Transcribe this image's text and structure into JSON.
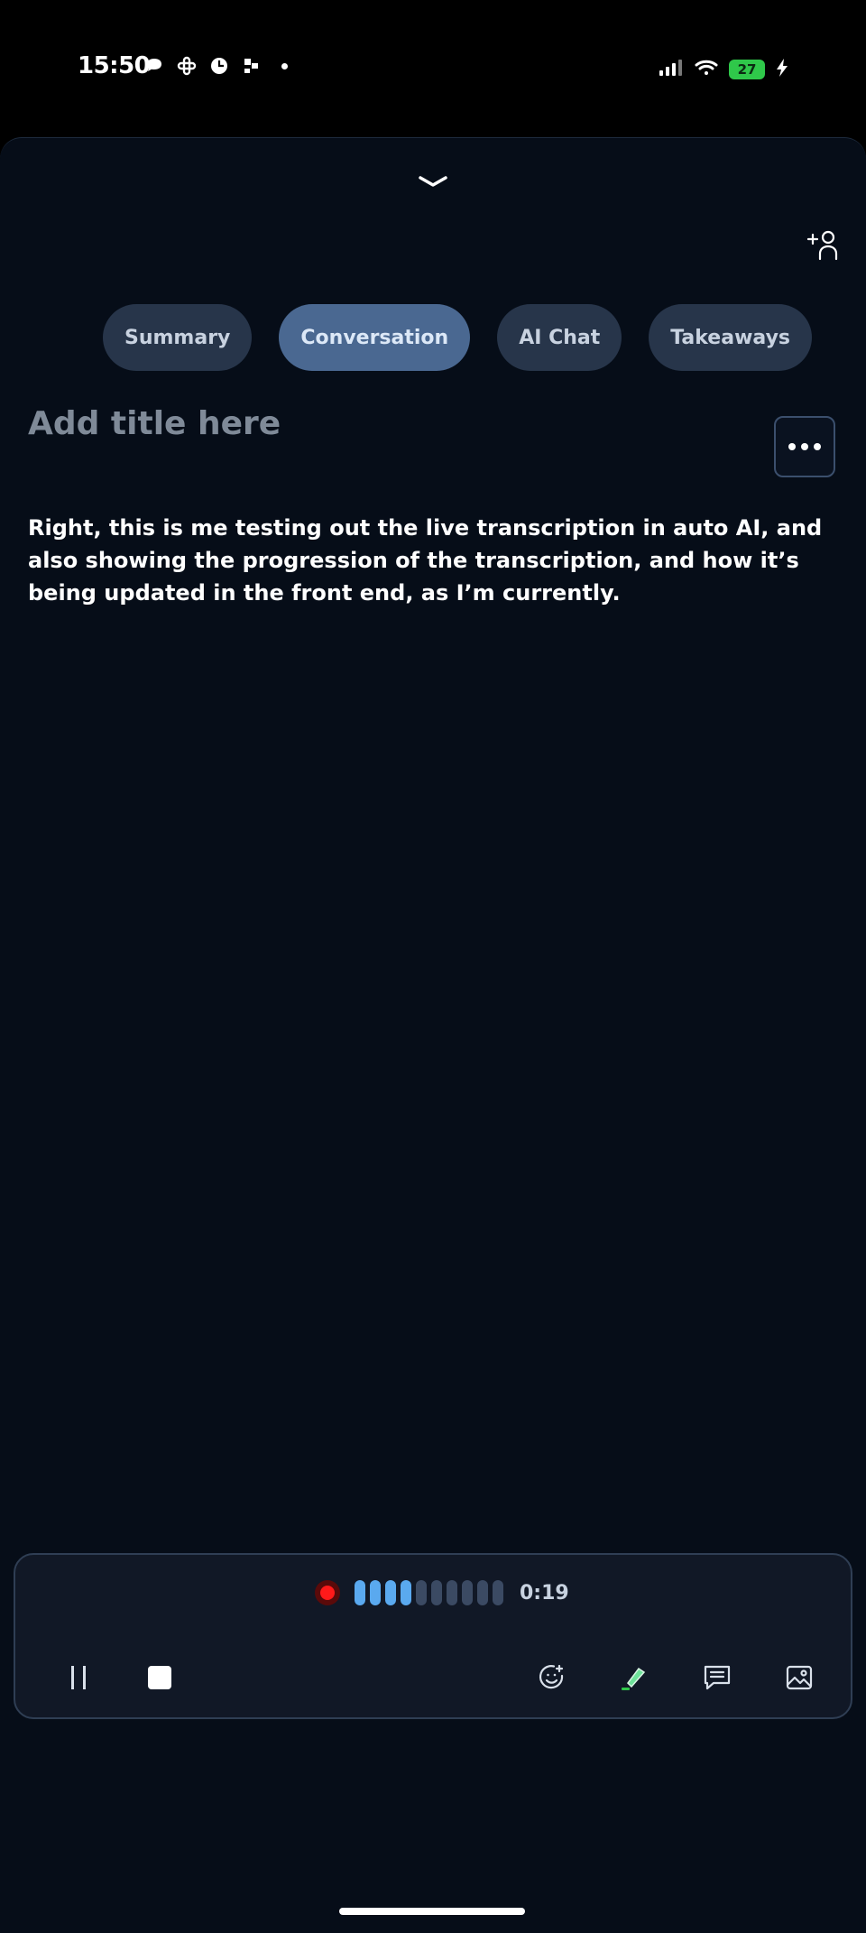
{
  "status_bar": {
    "time": "15:50",
    "battery": "27",
    "icons": [
      "chat-bubble-icon",
      "slack-icon",
      "timer-icon",
      "app-icon",
      "dot-icon",
      "signal-icon",
      "wifi-icon",
      "battery-icon",
      "charging-icon"
    ]
  },
  "tabs": [
    {
      "label": "Summary",
      "active": false
    },
    {
      "label": "Conversation",
      "active": true
    },
    {
      "label": "AI Chat",
      "active": false
    },
    {
      "label": "Takeaways",
      "active": false
    }
  ],
  "title_placeholder": "Add title here",
  "transcript": "Right, this is me testing out the live transcription in auto AI, and also showing the progression of the transcription, and how it’s being updated in the front end, as I’m currently.",
  "recorder": {
    "elapsed": "0:19",
    "level_bars_total": 10,
    "level_bars_active": 4
  },
  "colors": {
    "background": "#060d18",
    "active_tab": "#4a6891",
    "tab": "#27354a",
    "record": "#ff1a1a",
    "level_active": "#5aa9ef"
  }
}
